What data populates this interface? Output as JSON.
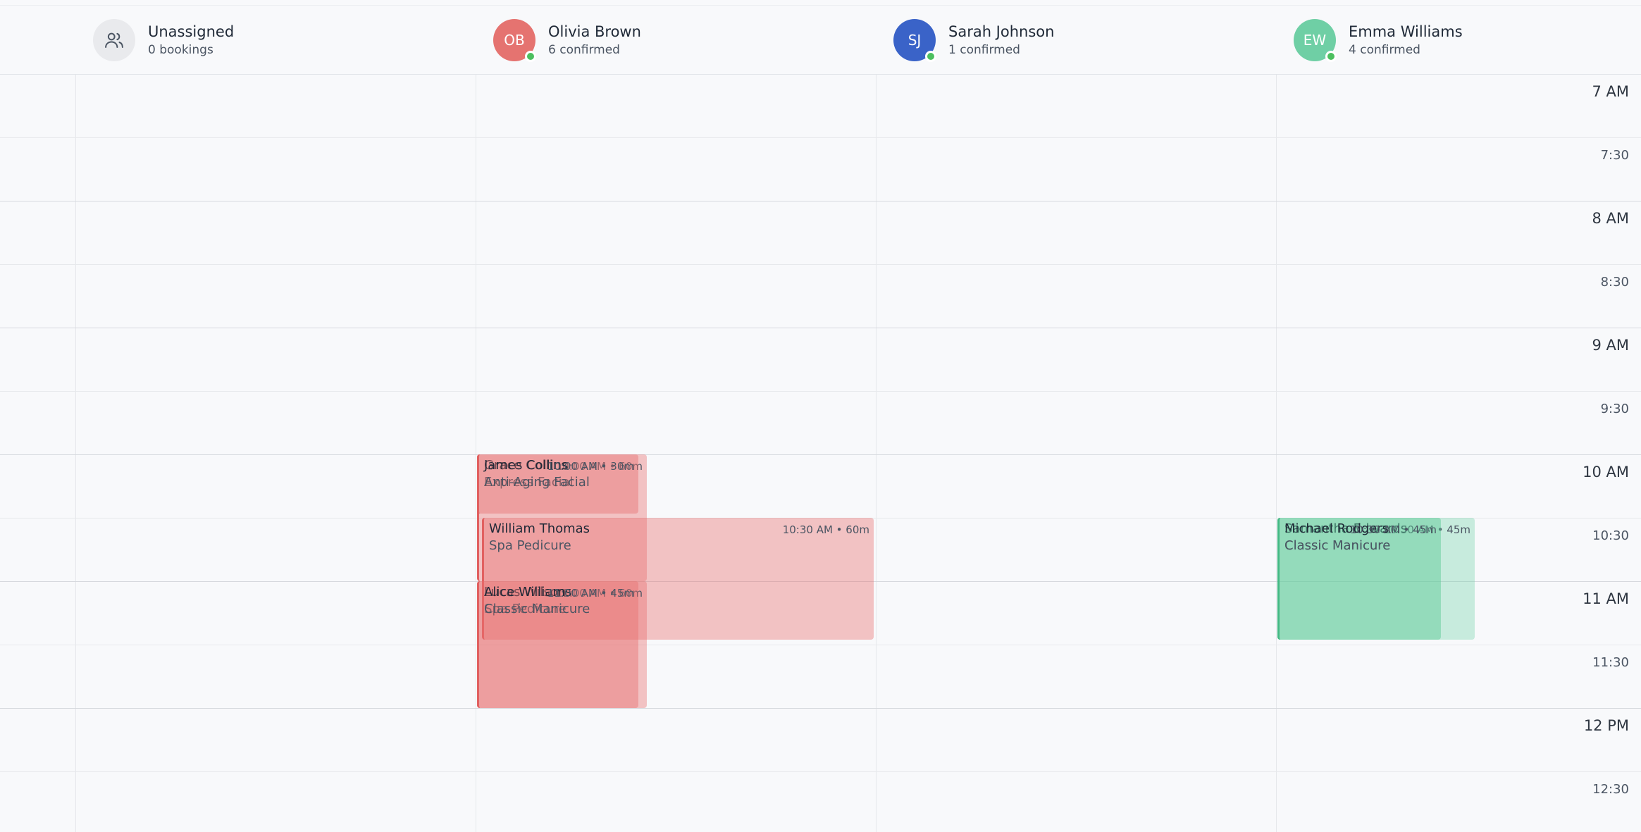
{
  "staff": [
    {
      "name": "Unassigned",
      "sub": "0 bookings",
      "initials": "",
      "color": "#e9eaed",
      "online": false,
      "icon": "users-icon"
    },
    {
      "name": "Olivia Brown",
      "sub": "6 confirmed",
      "initials": "OB",
      "color": "#e57370",
      "online": true
    },
    {
      "name": "Sarah Johnson",
      "sub": "1 confirmed",
      "initials": "SJ",
      "color": "#3a63c8",
      "online": true
    },
    {
      "name": "Emma Williams",
      "sub": "4 confirmed",
      "initials": "EW",
      "color": "#6fcfa5",
      "online": true
    }
  ],
  "time_labels": [
    "7 AM",
    "7:30",
    "8 AM",
    "8:30",
    "9 AM",
    "9:30",
    "10 AM",
    "10:30",
    "11 AM",
    "11:30",
    "12 PM",
    "12:30"
  ],
  "appointments": [
    {
      "client": "Grace Collins",
      "service": "Express Facial",
      "time": "10:00 AM • 60m",
      "color": "red"
    },
    {
      "client": "James Collins",
      "service": "Anti-Aging Facial",
      "time": "10:00 AM • 30m",
      "color": "red"
    },
    {
      "client": "William Thomas",
      "service": "Spa Pedicure",
      "time": "10:30 AM • 60m",
      "color": "red"
    },
    {
      "client": "Lucas Wilson",
      "service": "Spa Pedicure",
      "time": "11:00 AM • 60m",
      "color": "red"
    },
    {
      "client": "Alice Williams",
      "service": "Classic Manicure",
      "time": "11:00 AM • 45m",
      "color": "red"
    },
    {
      "client": "Samantha Edwards",
      "service": "Classic Manicure",
      "time": "10:30 AM • 45m",
      "color": "green"
    },
    {
      "client": "Michael Rodgers",
      "service": "Classic Manicure",
      "time": "10:30 AM • 45m",
      "color": "green"
    }
  ]
}
